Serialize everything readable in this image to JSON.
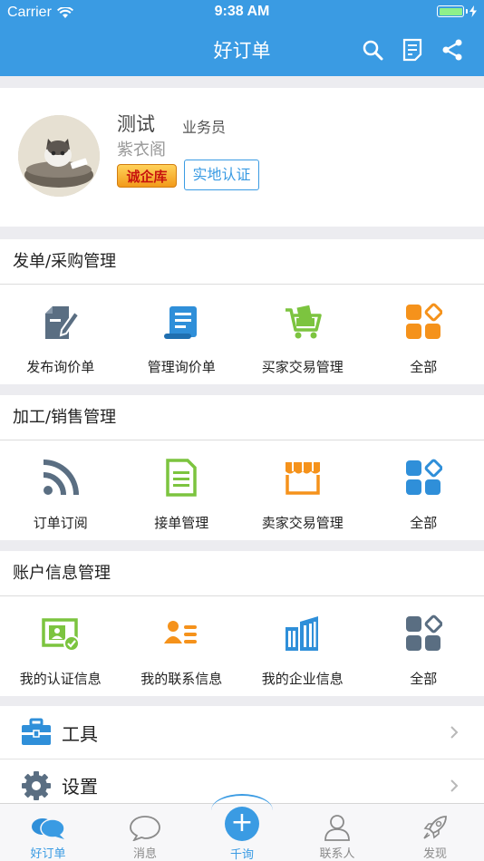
{
  "status_bar": {
    "carrier": "Carrier",
    "time": "9:38 AM"
  },
  "nav": {
    "title": "好订单",
    "icons": [
      "search-icon",
      "note-icon",
      "share-icon"
    ]
  },
  "profile": {
    "name": "测试",
    "role": "业务员",
    "company": "紫衣阁",
    "badge": "诚企库",
    "verify_button": "实地认证"
  },
  "sections": [
    {
      "title": "发单/采购管理",
      "items": [
        {
          "label": "发布询价单",
          "icon": "edit-document-icon",
          "color": "#5a6e82"
        },
        {
          "label": "管理询价单",
          "icon": "scroll-document-icon",
          "color": "#2f8fd9"
        },
        {
          "label": "买家交易管理",
          "icon": "shopping-cart-icon",
          "color": "#7cc43f"
        },
        {
          "label": "全部",
          "icon": "grid-all-icon",
          "color": "#f5921b"
        }
      ]
    },
    {
      "title": "加工/销售管理",
      "items": [
        {
          "label": "订单订阅",
          "icon": "rss-feed-icon",
          "color": "#5a6e82"
        },
        {
          "label": "接单管理",
          "icon": "document-list-icon",
          "color": "#7cc43f"
        },
        {
          "label": "卖家交易管理",
          "icon": "storefront-icon",
          "color": "#f5921b"
        },
        {
          "label": "全部",
          "icon": "grid-all-icon",
          "color": "#2f8fd9"
        }
      ]
    },
    {
      "title": "账户信息管理",
      "items": [
        {
          "label": "我的认证信息",
          "icon": "id-card-verified-icon",
          "color": "#7cc43f"
        },
        {
          "label": "我的联系信息",
          "icon": "contact-card-icon",
          "color": "#f5921b"
        },
        {
          "label": "我的企业信息",
          "icon": "building-icon",
          "color": "#2f8fd9"
        },
        {
          "label": "全部",
          "icon": "grid-all-icon",
          "color": "#5a6e82"
        }
      ]
    }
  ],
  "menu": [
    {
      "label": "工具",
      "icon": "toolbox-icon"
    },
    {
      "label": "设置",
      "icon": "gear-icon"
    }
  ],
  "tabbar": {
    "tabs": [
      {
        "label": "好订单",
        "icon": "chat-bubbles-icon",
        "active": true
      },
      {
        "label": "消息",
        "icon": "message-bubble-icon",
        "active": false
      },
      {
        "label": "千询",
        "icon": "plus-icon",
        "active": false
      },
      {
        "label": "联系人",
        "icon": "person-icon",
        "active": false
      },
      {
        "label": "发现",
        "icon": "rocket-icon",
        "active": false
      }
    ]
  },
  "colors": {
    "primary": "#3a9be3",
    "background": "#ececf0"
  }
}
